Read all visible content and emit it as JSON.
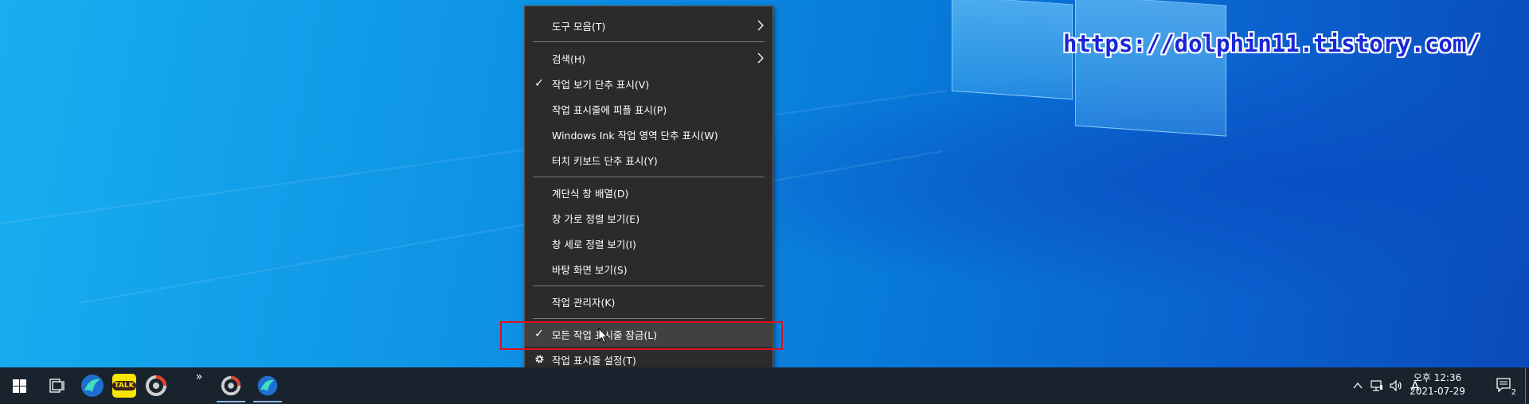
{
  "watermark": "https://dolphin11.tistory.com/",
  "context_menu": {
    "items": [
      {
        "label": "도구 모음(T)",
        "submenu": true
      },
      {
        "label": "검색(H)",
        "submenu": true
      },
      {
        "label": "작업 보기 단추 표시(V)",
        "checked": true
      },
      {
        "label": "작업 표시줄에 피플 표시(P)"
      },
      {
        "label": "Windows Ink 작업 영역 단추 표시(W)"
      },
      {
        "label": "터치 키보드 단추 표시(Y)"
      },
      {
        "label": "계단식 창 배열(D)"
      },
      {
        "label": "창 가로 정렬 보기(E)"
      },
      {
        "label": "창 세로 정렬 보기(I)"
      },
      {
        "label": "바탕 화면 보기(S)"
      },
      {
        "label": "작업 관리자(K)"
      },
      {
        "label": "모든 작업 표시줄 잠금(L)",
        "checked": true,
        "highlighted": true
      },
      {
        "label": "작업 표시줄 설정(T)",
        "icon": "gear-icon"
      }
    ],
    "check_glyph": "✓"
  },
  "taskbar": {
    "overflow_label": "»",
    "kakao_label": "TALK",
    "clock": {
      "time": "오후 12:36",
      "date": "2021-07-29"
    },
    "ime_indicator": "A",
    "notification_count": "2"
  },
  "colors": {
    "menu_bg": "#2b2b2b",
    "highlight": "#e0101a",
    "taskbar_bg": "#19232d",
    "watermark": "#1a27d6"
  }
}
